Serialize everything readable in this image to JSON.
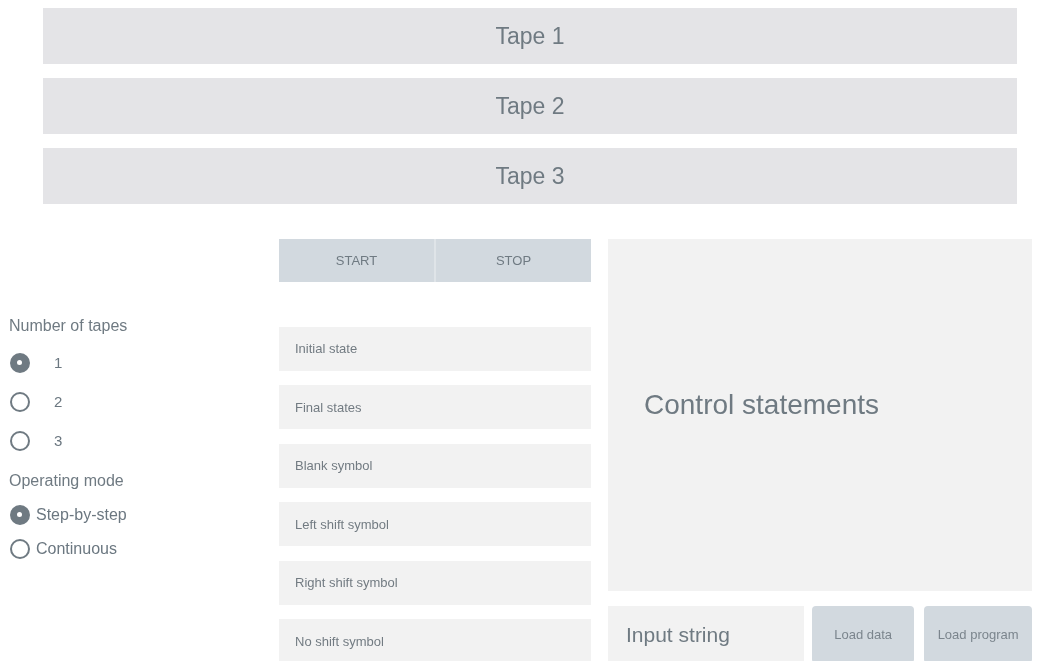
{
  "tapes": [
    {
      "label": "Tape 1"
    },
    {
      "label": "Tape 2"
    },
    {
      "label": "Tape 3"
    }
  ],
  "number_of_tapes": {
    "label": "Number of tapes",
    "options": [
      {
        "label": "1",
        "selected": true
      },
      {
        "label": "2",
        "selected": false
      },
      {
        "label": "3",
        "selected": false
      }
    ]
  },
  "operating_mode": {
    "label": "Operating mode",
    "options": [
      {
        "label": "Step-by-step",
        "selected": true
      },
      {
        "label": "Continuous",
        "selected": false
      }
    ]
  },
  "controls": [
    "START",
    "STOP"
  ],
  "fields": [
    {
      "placeholder": "Initial state"
    },
    {
      "placeholder": "Final states"
    },
    {
      "placeholder": "Blank symbol"
    },
    {
      "placeholder": "Left shift symbol"
    },
    {
      "placeholder": "Right shift symbol"
    },
    {
      "placeholder": "No shift symbol"
    }
  ],
  "control_statements": {
    "placeholder": "Control statements"
  },
  "input_string": {
    "placeholder": "Input string"
  },
  "buttons": [
    "Load data",
    "Load program"
  ]
}
